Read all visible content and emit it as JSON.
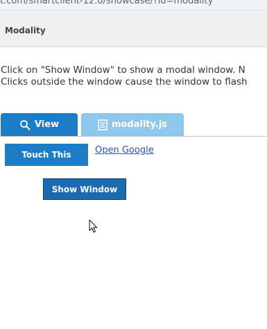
{
  "browser": {
    "url_fragment": "t.com/smartclient-12.0/showcase/?id=modality"
  },
  "header": {
    "title": "Modality"
  },
  "description": {
    "line1": "Click on \"Show Window\" to show a modal window. N",
    "line2": "Clicks outside the window cause the window to flash"
  },
  "tabs": [
    {
      "label": "View",
      "icon": "search-icon",
      "selected": true
    },
    {
      "label": "modality.js",
      "icon": "code-file-icon",
      "selected": false
    }
  ],
  "controls": {
    "touch_button_label": "Touch This",
    "google_link_label": "Open Google",
    "show_window_label": "Show Window"
  },
  "colors": {
    "tab_selected": "#1c7dc7",
    "tab_unselected": "#8fc6ec",
    "button_blue": "#1c7dc7",
    "button_show_window": "#1a6bb0",
    "link": "#2a52be"
  }
}
